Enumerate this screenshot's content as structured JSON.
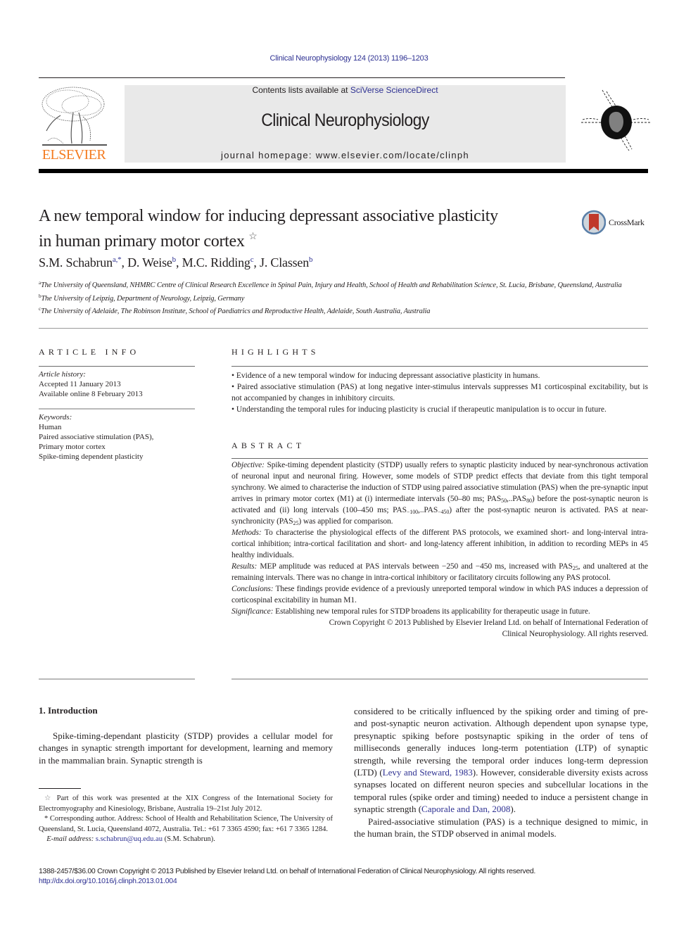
{
  "header": {
    "citation": "Clinical Neurophysiology 124 (2013) 1196–1203",
    "contents_prefix": "Contents lists available at ",
    "contents_link": "SciVerse ScienceDirect",
    "journal_name": "Clinical Neurophysiology",
    "homepage": "journal homepage: www.elsevier.com/locate/clinph",
    "publisher_logo_text": "ELSEVIER",
    "colors": {
      "link": "#2e3192",
      "elsevier_orange": "#f47b20",
      "masthead_bg": "#e9e9e9"
    }
  },
  "article": {
    "title_line1": "A new temporal window for inducing depressant associative plasticity",
    "title_line2": "in human primary motor cortex",
    "title_mark": "☆",
    "crossmark_label": "CrossMark",
    "authors": [
      {
        "name": "S.M. Schabrun",
        "sup": "a,*"
      },
      {
        "name": "D. Weise",
        "sup": "b"
      },
      {
        "name": "M.C. Ridding",
        "sup": "c"
      },
      {
        "name": "J. Classen",
        "sup": "b"
      }
    ],
    "author_separator": ", ",
    "affiliations": [
      {
        "mark": "a",
        "text": "The University of Queensland, NHMRC Centre of Clinical Research Excellence in Spinal Pain, Injury and Health, School of Health and Rehabilitation Science, St. Lucia, Brisbane, Queensland, Australia"
      },
      {
        "mark": "b",
        "text": "The University of Leipzig, Department of Neurology, Leipzig, Germany"
      },
      {
        "mark": "c",
        "text": "The University of Adelaide, The Robinson Institute, School of Paediatrics and Reproductive Health, Adelaide, South Australia, Australia"
      }
    ]
  },
  "article_info": {
    "heading": "ARTICLE INFO",
    "history_label": "Article history:",
    "history": [
      "Accepted 11 January 2013",
      "Available online 8 February 2013"
    ],
    "keywords_label": "Keywords:",
    "keywords": [
      "Human",
      "Paired associative stimulation (PAS),",
      "Primary motor cortex",
      "Spike-timing dependent plasticity"
    ]
  },
  "highlights": {
    "heading": "HIGHLIGHTS",
    "items": [
      "• Evidence of a new temporal window for inducing depressant associative plasticity in humans.",
      "• Paired associative stimulation (PAS) at long negative inter-stimulus intervals suppresses M1 corticospinal excitability, but is not accompanied by changes in inhibitory circuits.",
      "• Understanding the temporal rules for inducing plasticity is crucial if therapeutic manipulation is to occur in future."
    ]
  },
  "abstract": {
    "heading": "ABSTRACT",
    "objective_label": "Objective:",
    "objective_1": " Spike-timing dependent plasticity (STDP) usually refers to synaptic plasticity induced by near-synchronous activation of neuronal input and neuronal firing. However, some models of STDP predict effects that deviate from this tight temporal synchrony. We aimed to characterise the induction of STDP using paired associative stimulation (PAS) when the pre-synaptic input arrives in primary motor cortex (M1) at (i) intermediate intervals (50–80 ms; PAS",
    "sub_50": "50",
    "objective_2": ",..PAS",
    "sub_80": "80",
    "objective_3": ") before the post-synaptic neuron is activated and (ii) long intervals (100–450 ms; PAS",
    "sub_m100": "−100",
    "objective_4": ",..PAS",
    "sub_m450": "−450",
    "objective_5": ") after the post-synaptic neuron is activated. PAS at near-synchronicity (PAS",
    "sub_25": "25",
    "objective_6": ") was applied for comparison.",
    "methods_label": "Methods:",
    "methods": " To characterise the physiological effects of the different PAS protocols, we examined short- and long-interval intra-cortical inhibition; intra-cortical facilitation and short- and long-latency afferent inhibition, in addition to recording MEPs in 45 healthy individuals.",
    "results_label": "Results:",
    "results_1": " MEP amplitude was reduced at PAS intervals between −250 and −450 ms, increased with PAS",
    "results_sub": "25",
    "results_2": ", and unaltered at the remaining intervals. There was no change in intra-cortical inhibitory or facilitatory circuits following any PAS protocol.",
    "conclusions_label": "Conclusions:",
    "conclusions": " These findings provide evidence of a previously unreported temporal window in which PAS induces a depression of corticospinal excitability in human M1.",
    "significance_label": "Significance:",
    "significance": " Establishing new temporal rules for STDP broadens its applicability for therapeutic usage in future.",
    "copyright_1": "Crown Copyright © 2013 Published by Elsevier Ireland Ltd. on behalf of International Federation of",
    "copyright_2": "Clinical Neurophysiology. All rights reserved."
  },
  "body": {
    "intro_heading": "1. Introduction",
    "left_para": "Spike-timing-dependant plasticity (STDP) provides a cellular model for changes in synaptic strength important for development, learning and memory in the mammalian brain. Synaptic strength is",
    "right_para1_a": "considered to be critically influenced by the spiking order and timing of pre- and post-synaptic neuron activation. Although dependent upon synapse type, presynaptic spiking before postsynaptic spiking in the order of tens of milliseconds generally induces long-term potentiation (LTP) of synaptic strength, while reversing the temporal order induces long-term depression (LTD) (",
    "ref1": "Levy and Steward, 1983",
    "right_para1_b": "). However, considerable diversity exists across synapses located on different neuron species and subcellular locations in the temporal rules (spike order and timing) needed to induce a persistent change in synaptic strength (",
    "ref2": "Caporale and Dan, 2008",
    "right_para1_c": ").",
    "right_para2": "Paired-associative stimulation (PAS) is a technique designed to mimic, in the human brain, the STDP observed in animal models."
  },
  "footnotes": {
    "star_mark": "☆",
    "star_text": " Part of this work was presented at the XIX Congress of the International Society for Electromyography and Kinesiology, Brisbane, Australia 19–21st July 2012.",
    "corr_mark": "*",
    "corr_text": " Corresponding author. Address: School of Health and Rehabilitation Science, The University of Queensland, St. Lucia, Queensland 4072, Australia. Tel.: +61 7 3365 4590; fax: +61 7 3365 1284.",
    "email_label": "E-mail address:",
    "email": "s.schabrun@uq.edu.au",
    "email_suffix": " (S.M. Schabrun)."
  },
  "bottom": {
    "issn_line": "1388-2457/$36.00 Crown Copyright © 2013 Published by Elsevier Ireland Ltd. on behalf of International Federation of Clinical Neurophysiology. All rights reserved.",
    "doi": "http://dx.doi.org/10.1016/j.clinph.2013.01.004"
  }
}
